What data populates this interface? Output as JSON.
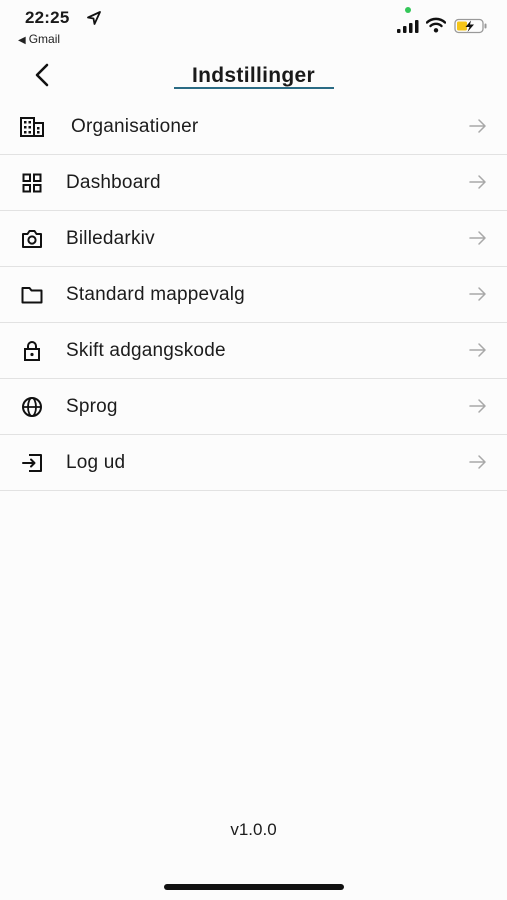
{
  "status": {
    "time": "22:25",
    "back_app": "Gmail"
  },
  "nav": {
    "title": "Indstillinger",
    "back_icon": "chevron-left-icon"
  },
  "menu": {
    "items": [
      {
        "label": "Organisationer",
        "icon": "building-icon"
      },
      {
        "label": "Dashboard",
        "icon": "grid-icon"
      },
      {
        "label": "Billedarkiv",
        "icon": "camera-icon"
      },
      {
        "label": "Standard mappevalg",
        "icon": "folder-icon"
      },
      {
        "label": "Skift adgangskode",
        "icon": "lock-icon"
      },
      {
        "label": "Sprog",
        "icon": "globe-icon"
      },
      {
        "label": "Log ud",
        "icon": "logout-icon"
      }
    ]
  },
  "footer": {
    "version": "v1.0.0"
  },
  "colors": {
    "accent_underline": "#2a6b84",
    "battery_fill": "#f5c518",
    "privacy_dot": "#34c759"
  }
}
